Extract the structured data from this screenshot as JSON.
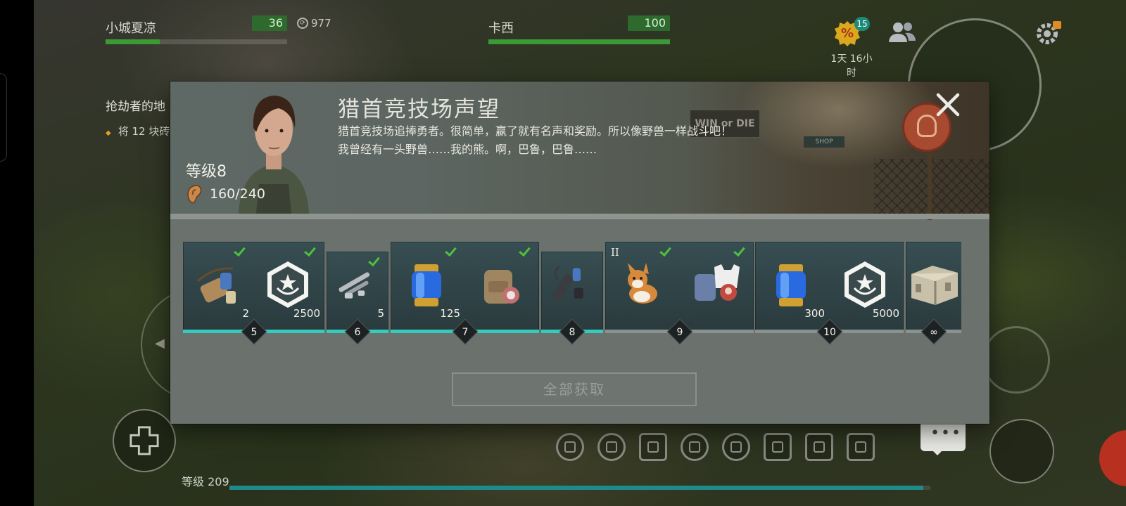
{
  "hud": {
    "player1": {
      "name": "小城夏凉",
      "value": "36",
      "health": 0.3
    },
    "player2": {
      "name": "卡西",
      "value": "100",
      "health": 1.0
    },
    "currency": "977",
    "promo_count": "15",
    "promo_time": "1天 16小时",
    "promo_symbol": "%"
  },
  "quest": {
    "title": "抢劫者的地",
    "task": "将 12 块砖"
  },
  "modal": {
    "title": "猎首竞技场声望",
    "description": "猎首竞技场追捧勇者。很简单，赢了就有名声和奖励。所以像野兽一样战斗吧！我曾经有一头野兽……我的熊。啊，巴鲁，巴鲁……",
    "level": "等级8",
    "progress": "160/240",
    "scene_sign": "WIN or DIE",
    "scene_shop": "SHOP",
    "claim_all": "全部获取"
  },
  "rewards": [
    {
      "level": "5",
      "claimed": true,
      "items": [
        {
          "icon": "ammo-pouch-icon",
          "qty": "2",
          "checked": true
        },
        {
          "icon": "reputation-badge-icon",
          "qty": "2500",
          "checked": true
        }
      ]
    },
    {
      "level": "6",
      "claimed": true,
      "items": [
        {
          "icon": "weapon-parts-icon",
          "qty": "5",
          "checked": true
        }
      ]
    },
    {
      "level": "7",
      "claimed": true,
      "items": [
        {
          "icon": "dna-capsule-icon",
          "qty": "125",
          "checked": true
        },
        {
          "icon": "backpack-icon",
          "qty": "",
          "checked": true
        }
      ]
    },
    {
      "level": "8",
      "claimed": true,
      "items": [
        {
          "icon": "silencer-icon",
          "qty": "",
          "checked": false
        }
      ]
    },
    {
      "level": "9",
      "claimed": false,
      "tier": "II",
      "items": [
        {
          "icon": "corgi-pet-icon",
          "qty": "",
          "checked": true
        },
        {
          "icon": "outfit-icon",
          "qty": "",
          "checked": true
        }
      ]
    },
    {
      "level": "10",
      "claimed": false,
      "items": [
        {
          "icon": "dna-capsule-icon",
          "qty": "300",
          "checked": false
        },
        {
          "icon": "reputation-badge-icon",
          "qty": "5000",
          "checked": false
        }
      ]
    },
    {
      "level": "∞",
      "claimed": false,
      "items": [
        {
          "icon": "supply-crate-icon",
          "qty": "",
          "checked": false
        }
      ]
    }
  ],
  "bottom": {
    "level_label": "等级 209",
    "xp_progress": 0.99
  },
  "colors": {
    "progress_claimed": "#35cbbf",
    "check": "#4ec23c",
    "health": "#3c9a36"
  }
}
